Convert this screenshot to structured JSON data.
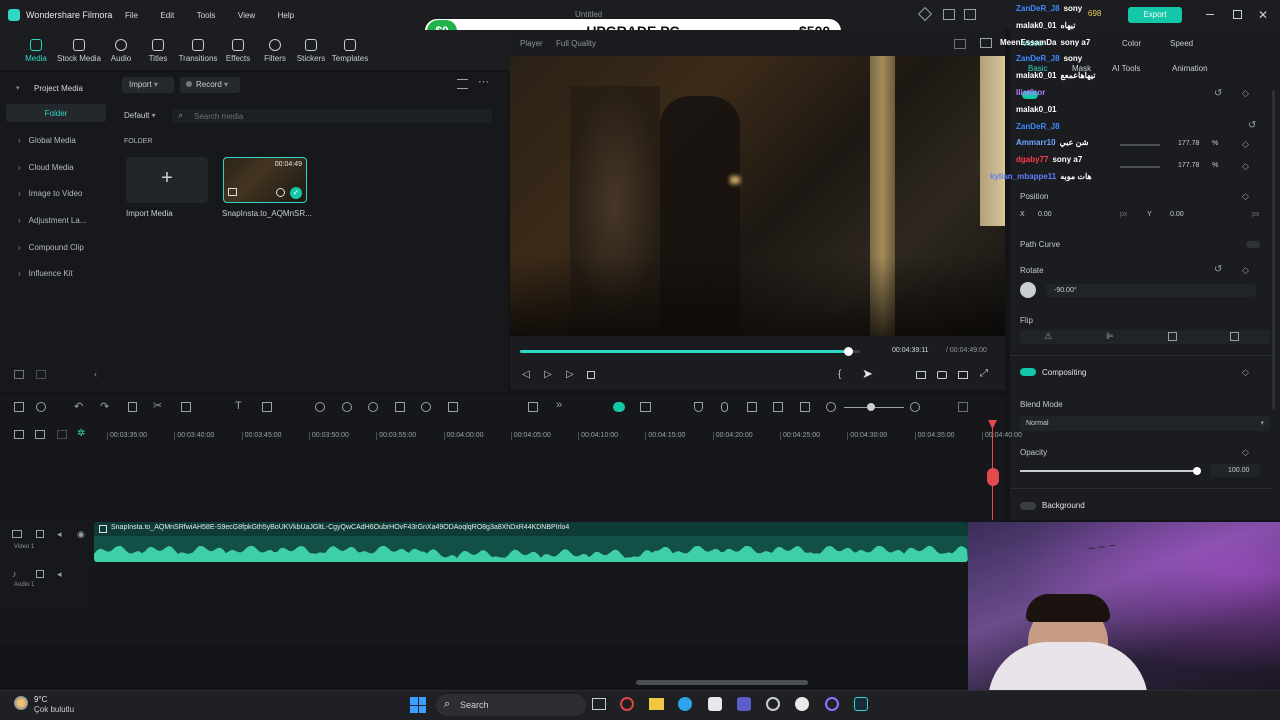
{
  "app": {
    "name": "Wondershare Filmora",
    "menu": [
      "File",
      "Edit",
      "Tools",
      "View",
      "Help"
    ],
    "doc_title": "Untitled",
    "export_label": "Export",
    "coins": "698"
  },
  "banner": {
    "left": "$0",
    "center": "UPGRADE PC",
    "right": "$500"
  },
  "toolbar": [
    "Media",
    "Stock Media",
    "Audio",
    "Titles",
    "Transitions",
    "Effects",
    "Filters",
    "Stickers",
    "Templates"
  ],
  "sidebar": {
    "header": "Project Media",
    "folder": "Folder",
    "items": [
      "Global Media",
      "Cloud Media",
      "Image to Video",
      "Adjustment La...",
      "Compound Clip",
      "Influence Kit"
    ]
  },
  "media_panel": {
    "import_label": "Import",
    "record_label": "Record",
    "sort_label": "Default",
    "search_placeholder": "Search media",
    "folder_label": "FOLDER",
    "import_tile_label": "Import Media",
    "clip_name": "SnapInsta.to_AQMnSR...",
    "clip_duration": "00:04:49"
  },
  "preview": {
    "tab_player": "Player",
    "tab_quality": "Full Quality",
    "current_time": "00:04:39:11",
    "total_time": "/ 00:04:49:00",
    "progress": 0.965
  },
  "props": {
    "tabs": [
      "Video",
      "Color",
      "Speed"
    ],
    "subtabs": [
      "Basic",
      "Mask",
      "AI Tools",
      "Animation"
    ],
    "scale_x": "177.78",
    "scale_y": "177.78",
    "percent": "%",
    "position_label": "Position",
    "x_label": "X",
    "x_value": "0.00",
    "y_label": "Y",
    "y_value": "0.00",
    "px_unit": "px",
    "path_curve_label": "Path Curve",
    "rotate_label": "Rotate",
    "rotate_value": "-90.00°",
    "flip_label": "Flip",
    "compositing_label": "Compositing",
    "blend_mode_label": "Blend Mode",
    "blend_mode_value": "Normal",
    "opacity_label": "Opacity",
    "opacity_value": "100.00",
    "background_label": "Background"
  },
  "timeline": {
    "ticks": [
      "00:03:35:00",
      "00:03:40:00",
      "00:03:45:00",
      "00:03:50:00",
      "00:03:55:00",
      "00:04:00:00",
      "00:04:05:00",
      "00:04:10:00",
      "00:04:15:00",
      "00:04:20:00",
      "00:04:25:00",
      "00:04:30:00",
      "00:04:35:00",
      "00:04:40:00"
    ],
    "clip_title": "SnapInsta.to_AQMnSRfwiAH58E-S9ecG8fpkGth5yBoUKVkbUaJGltL-CgyQwCAdH6OubrHOvF43rGnXa49ODAoqlqRO8g3a8XhDxR44KDNBPIrlo4",
    "video_track_label": "Video 1",
    "audio_track_label": "Audio 1"
  },
  "chat": [
    {
      "user": "ZanDeR_J8",
      "msg": "sony",
      "color": "#3b8cff"
    },
    {
      "user": "malak0_01",
      "msg": "تيهاه",
      "color": "#ffffff"
    },
    {
      "user": "MeenEssamDa",
      "msg": "sony a7",
      "color": "#ffffff"
    },
    {
      "user": "ZanDeR_J8",
      "msg": "sony",
      "color": "#3b8cff"
    },
    {
      "user": "malak0_01",
      "msg": "تيهاهاعمعع",
      "color": "#ffffff"
    },
    {
      "user": "Iliat0ror",
      "msg": "",
      "color": "#b07cff"
    },
    {
      "user": "malak0_01",
      "msg": "",
      "color": "#ffffff"
    },
    {
      "user": "ZanDeR_J8",
      "msg": "",
      "color": "#3b8cff"
    },
    {
      "user": "Ammarr10",
      "msg": "شن عبي",
      "color": "#6fa7ff"
    },
    {
      "user": "dgaby77",
      "msg": "sony a7",
      "color": "#ff3b4a"
    },
    {
      "user": "kylian_mbappe11",
      "msg": "هات موبه",
      "color": "#5f7dff"
    }
  ],
  "taskbar": {
    "temp": "9°C",
    "weather": "Çok bulutlu",
    "search_label": "Search"
  }
}
